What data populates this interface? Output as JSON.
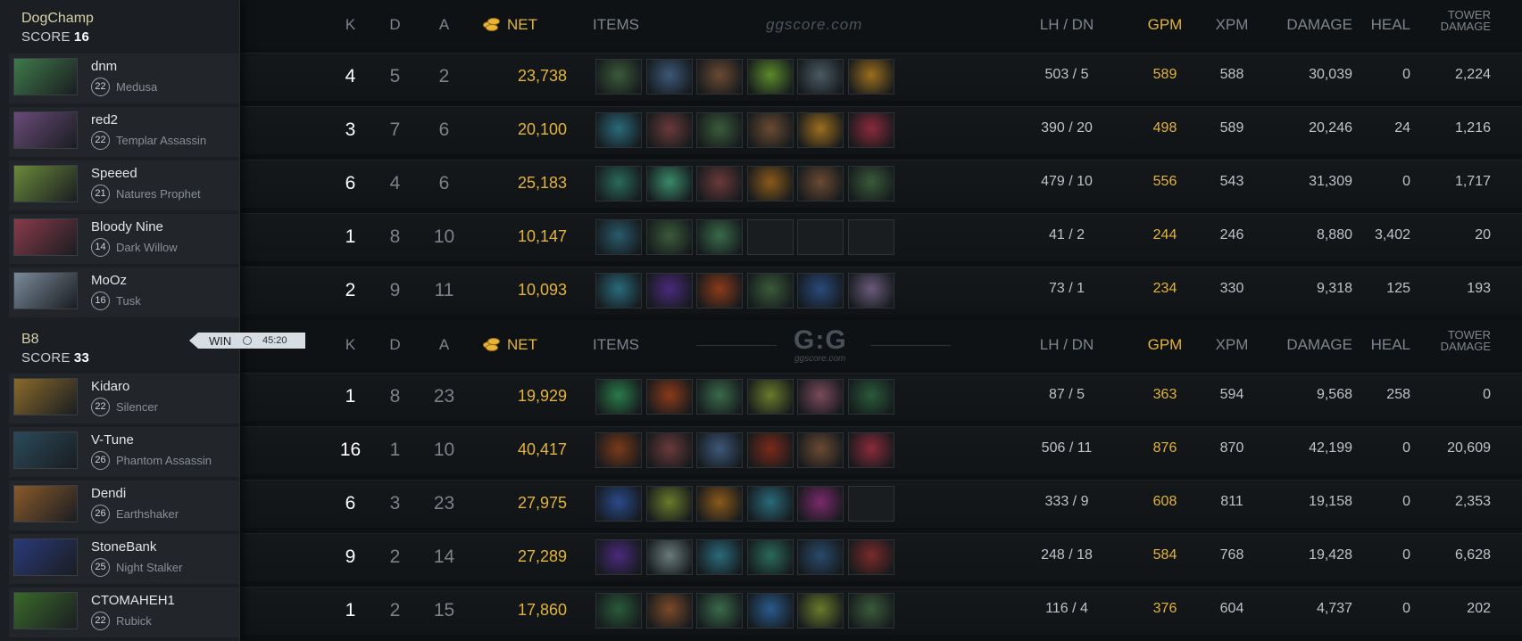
{
  "teams": [
    {
      "name": "DogChamp",
      "score_label": "SCORE",
      "score": "16",
      "players": [
        {
          "name": "dnm",
          "level": "22",
          "hero": "Medusa",
          "k": "4",
          "d": "5",
          "a": "2",
          "net": "23,738",
          "lh_dn": "503 / 5",
          "gpm": "589",
          "xpm": "588",
          "damage": "30,039",
          "heal": "0",
          "tower": "2,224",
          "portrait_color": "#3f7a4a",
          "items": [
            {
              "icon": "staff-item-icon",
              "color": "#3b5a3a"
            },
            {
              "icon": "axe-item-icon",
              "color": "#3d5878"
            },
            {
              "icon": "boots-item-icon",
              "color": "#6a4a32"
            },
            {
              "icon": "blade-item-icon",
              "color": "#5b8a2a"
            },
            {
              "icon": "eye-item-icon",
              "color": "#4a5a62"
            },
            {
              "icon": "rapier-item-icon",
              "color": "#9b6e1e"
            }
          ]
        },
        {
          "name": "red2",
          "level": "22",
          "hero": "Templar Assassin",
          "k": "3",
          "d": "7",
          "a": "6",
          "net": "20,100",
          "lh_dn": "390 / 20",
          "gpm": "498",
          "xpm": "589",
          "damage": "20,246",
          "heal": "24",
          "tower": "1,216",
          "portrait_color": "#6a4a7a",
          "items": [
            {
              "icon": "axe-item-icon",
              "color": "#2a6a7a"
            },
            {
              "icon": "claw-item-icon",
              "color": "#6a3a3a"
            },
            {
              "icon": "staff-item-icon",
              "color": "#3b5a3a"
            },
            {
              "icon": "boots-item-icon",
              "color": "#6a4a32"
            },
            {
              "icon": "rapier-item-icon",
              "color": "#9b6e1e"
            },
            {
              "icon": "scythe-item-icon",
              "color": "#8a2a3a"
            }
          ]
        },
        {
          "name": "Speeed",
          "level": "21",
          "hero": "Natures Prophet",
          "k": "6",
          "d": "4",
          "a": "6",
          "net": "25,183",
          "lh_dn": "479 / 10",
          "gpm": "556",
          "xpm": "543",
          "damage": "31,309",
          "heal": "0",
          "tower": "1,717",
          "portrait_color": "#6a8a3a",
          "items": [
            {
              "icon": "armor-item-icon",
              "color": "#2a6a5a"
            },
            {
              "icon": "wisp-item-icon",
              "color": "#3a8a6a"
            },
            {
              "icon": "claw-item-icon",
              "color": "#6a3a3a"
            },
            {
              "icon": "helm-item-icon",
              "color": "#8a5a1a"
            },
            {
              "icon": "boots-item-icon",
              "color": "#6a4a32"
            },
            {
              "icon": "staff-item-icon",
              "color": "#3b5a3a"
            }
          ]
        },
        {
          "name": "Bloody Nine",
          "level": "14",
          "hero": "Dark Willow",
          "k": "1",
          "d": "8",
          "a": "10",
          "net": "10,147",
          "lh_dn": "41 / 2",
          "gpm": "244",
          "xpm": "246",
          "damage": "8,880",
          "heal": "3,402",
          "tower": "20",
          "portrait_color": "#8a3a4a",
          "items": [
            {
              "icon": "boots-item-icon",
              "color": "#2a5a6a"
            },
            {
              "icon": "staff-item-icon",
              "color": "#3b5a3a"
            },
            {
              "icon": "wand-item-icon",
              "color": "#3a6a4a"
            },
            {
              "icon": "empty-slot-icon",
              "color": ""
            },
            {
              "icon": "empty-slot-icon",
              "color": ""
            },
            {
              "icon": "empty-slot-icon",
              "color": ""
            }
          ]
        },
        {
          "name": "MoOz",
          "level": "16",
          "hero": "Tusk",
          "k": "2",
          "d": "9",
          "a": "11",
          "net": "10,093",
          "lh_dn": "73 / 1",
          "gpm": "234",
          "xpm": "330",
          "damage": "9,318",
          "heal": "125",
          "tower": "193",
          "portrait_color": "#7a8a9a",
          "items": [
            {
              "icon": "axe-item-icon",
              "color": "#2a6a7a"
            },
            {
              "icon": "cloak-item-icon",
              "color": "#4a2a7a"
            },
            {
              "icon": "shield-item-icon",
              "color": "#8a3a1a"
            },
            {
              "icon": "staff-item-icon",
              "color": "#3b5a3a"
            },
            {
              "icon": "potion-item-icon",
              "color": "#2a4a7a"
            },
            {
              "icon": "hood-item-icon",
              "color": "#6a5a7a"
            }
          ]
        }
      ]
    },
    {
      "name": "B8",
      "score_label": "SCORE",
      "score": "33",
      "players": [
        {
          "name": "Kidaro",
          "level": "22",
          "hero": "Silencer",
          "k": "1",
          "d": "8",
          "a": "23",
          "net": "19,929",
          "lh_dn": "87 / 5",
          "gpm": "363",
          "xpm": "594",
          "damage": "9,568",
          "heal": "258",
          "tower": "0",
          "portrait_color": "#8a6a2a",
          "items": [
            {
              "icon": "boots-item-icon",
              "color": "#2a7a4a"
            },
            {
              "icon": "shield-item-icon",
              "color": "#8a3a1a"
            },
            {
              "icon": "wand-item-icon",
              "color": "#3a6a4a"
            },
            {
              "icon": "trident-item-icon",
              "color": "#6a7a2a"
            },
            {
              "icon": "orb-item-icon",
              "color": "#7a4a5a"
            },
            {
              "icon": "crown-item-icon",
              "color": "#2a5a3a"
            }
          ]
        },
        {
          "name": "V-Tune",
          "level": "26",
          "hero": "Phantom Assassin",
          "k": "16",
          "d": "1",
          "a": "10",
          "net": "40,417",
          "lh_dn": "506 / 11",
          "gpm": "876",
          "xpm": "870",
          "damage": "42,199",
          "heal": "0",
          "tower": "20,609",
          "portrait_color": "#2a4a5a",
          "items": [
            {
              "icon": "cleaver-item-icon",
              "color": "#7a3a1a"
            },
            {
              "icon": "claw-item-icon",
              "color": "#6a3a3a"
            },
            {
              "icon": "axe-item-icon",
              "color": "#3d5878"
            },
            {
              "icon": "battlefury-item-icon",
              "color": "#7a2a1a"
            },
            {
              "icon": "boots-item-icon",
              "color": "#6a4a32"
            },
            {
              "icon": "scythe-item-icon",
              "color": "#8a2a3a"
            }
          ]
        },
        {
          "name": "Dendi",
          "level": "26",
          "hero": "Earthshaker",
          "k": "6",
          "d": "3",
          "a": "23",
          "net": "27,975",
          "lh_dn": "333 / 9",
          "gpm": "608",
          "xpm": "811",
          "damage": "19,158",
          "heal": "0",
          "tower": "2,353",
          "portrait_color": "#8a5a2a",
          "items": [
            {
              "icon": "dagger-item-icon",
              "color": "#2a4a8a"
            },
            {
              "icon": "trident-item-icon",
              "color": "#6a7a2a"
            },
            {
              "icon": "helm-item-icon",
              "color": "#8a5a1a"
            },
            {
              "icon": "axe-item-icon",
              "color": "#2a6a7a"
            },
            {
              "icon": "orb-item-icon",
              "color": "#7a2a6a"
            },
            {
              "icon": "empty-slot-icon",
              "color": ""
            }
          ]
        },
        {
          "name": "StoneBank",
          "level": "25",
          "hero": "Night Stalker",
          "k": "9",
          "d": "2",
          "a": "14",
          "net": "27,289",
          "lh_dn": "248 / 18",
          "gpm": "584",
          "xpm": "768",
          "damage": "19,428",
          "heal": "0",
          "tower": "6,628",
          "portrait_color": "#2a3a7a",
          "items": [
            {
              "icon": "cloak-item-icon",
              "color": "#4a2a7a"
            },
            {
              "icon": "axe-item-icon",
              "color": "#6a7a7a"
            },
            {
              "icon": "axe-item-icon",
              "color": "#2a6a7a"
            },
            {
              "icon": "armor-item-icon",
              "color": "#2a6a5a"
            },
            {
              "icon": "spear-item-icon",
              "color": "#2a4a6a"
            },
            {
              "icon": "hammer-item-icon",
              "color": "#7a2a2a"
            }
          ]
        },
        {
          "name": "CTOMAHEH1",
          "level": "22",
          "hero": "Rubick",
          "k": "1",
          "d": "2",
          "a": "15",
          "net": "17,860",
          "lh_dn": "116 / 4",
          "gpm": "376",
          "xpm": "604",
          "damage": "4,737",
          "heal": "0",
          "tower": "202",
          "portrait_color": "#3a6a2a",
          "items": [
            {
              "icon": "gem-item-icon",
              "color": "#2a5a3a"
            },
            {
              "icon": "shield-item-icon",
              "color": "#7a4a2a"
            },
            {
              "icon": "wand-item-icon",
              "color": "#3a6a4a"
            },
            {
              "icon": "globe-item-icon",
              "color": "#2a5a8a"
            },
            {
              "icon": "trident-item-icon",
              "color": "#6a7a2a"
            },
            {
              "icon": "staff-item-icon",
              "color": "#3b5a3a"
            }
          ]
        }
      ]
    }
  ],
  "columns": {
    "k": "K",
    "d": "D",
    "a": "A",
    "net": "NET",
    "items": "ITEMS",
    "lh_dn": "LH / DN",
    "gpm": "GPM",
    "xpm": "XPM",
    "damage": "DAMAGE",
    "heal": "HEAL",
    "tower_line1": "TOWER",
    "tower_line2": "DAMAGE"
  },
  "watermark_top": "ggscore.com",
  "watermark_logo": "G:G",
  "watermark_logo_sub": "ggscore.com",
  "result": {
    "label": "WIN",
    "duration": "45:20"
  },
  "colors": {
    "gold": "#e2b43d",
    "team_name": "#d6d0a8"
  }
}
